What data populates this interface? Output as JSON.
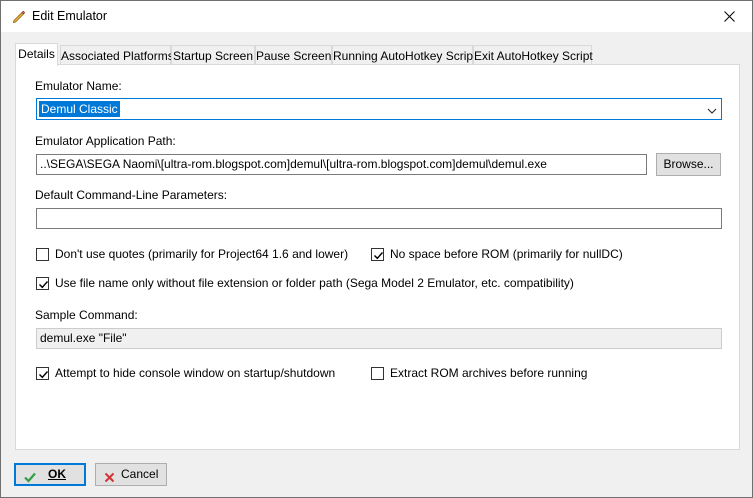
{
  "window": {
    "title": "Edit Emulator",
    "icon": "pencil-icon"
  },
  "tabs": [
    {
      "label": "Details",
      "active": true
    },
    {
      "label": "Associated Platforms",
      "active": false
    },
    {
      "label": "Startup Screen",
      "active": false
    },
    {
      "label": "Pause Screen",
      "active": false
    },
    {
      "label": "Running AutoHotkey Script",
      "active": false
    },
    {
      "label": "Exit AutoHotkey Script",
      "active": false
    }
  ],
  "details": {
    "emulator_name_label": "Emulator Name:",
    "emulator_name_value": "Demul Classic",
    "app_path_label": "Emulator Application Path:",
    "app_path_value": "..\\SEGA\\SEGA Naomi\\[ultra-rom.blogspot.com]demul\\[ultra-rom.blogspot.com]demul\\demul.exe",
    "browse_label": "Browse...",
    "cmdline_label": "Default Command-Line Parameters:",
    "cmdline_value": "",
    "sample_label": "Sample Command:",
    "sample_value": "demul.exe \"File\""
  },
  "checkboxes": {
    "no_quotes": {
      "label": "Don't use quotes (primarily for Project64 1.6 and lower)",
      "checked": false
    },
    "no_space": {
      "label": "No space before ROM (primarily for nullDC)",
      "checked": true
    },
    "file_name_only": {
      "label": "Use file name only without file extension or folder path (Sega Model 2 Emulator, etc. compatibility)",
      "checked": true
    },
    "hide_console": {
      "label": "Attempt to hide console window on startup/shutdown",
      "checked": true
    },
    "extract_rom": {
      "label": "Extract ROM archives before running",
      "checked": false
    }
  },
  "footer": {
    "ok_label": "OK",
    "cancel_label": "Cancel"
  },
  "colors": {
    "accent": "#0078d7",
    "ok_check": "#2ea043",
    "cancel_x": "#d13438"
  }
}
